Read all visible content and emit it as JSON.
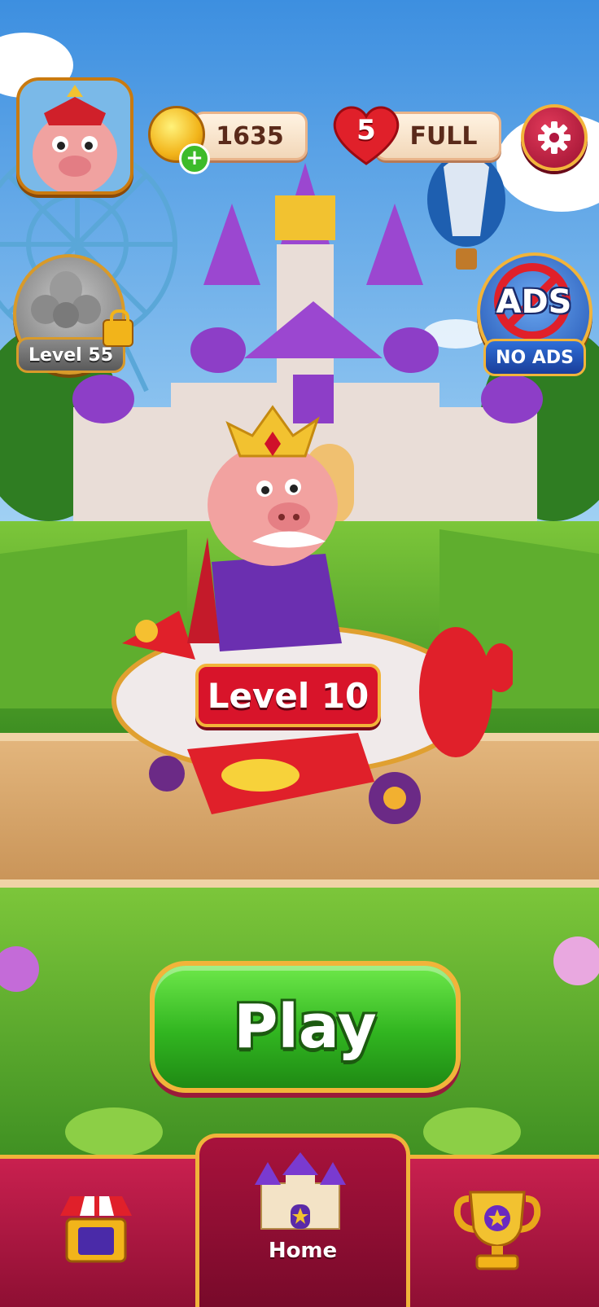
{
  "hud": {
    "coins": "1635",
    "lives": "5",
    "lives_status": "FULL"
  },
  "side": {
    "locked_level": "Level 55",
    "no_ads_title": "ADS",
    "no_ads_label": "NO ADS"
  },
  "scene": {
    "vehicle_level": "Level 10"
  },
  "play_button": "Play",
  "nav": {
    "active": "Home",
    "home_label": "Home"
  },
  "icons": [
    "avatar-pig",
    "coin-icon",
    "plus-icon",
    "heart-icon",
    "gear-icon",
    "lock-icon",
    "shop-icon",
    "castle-icon",
    "trophy-icon"
  ],
  "colors": {
    "play_green": "#39c22c",
    "nav_red": "#b0183f",
    "gold": "#f0b43a",
    "heart_red": "#e0202a"
  }
}
